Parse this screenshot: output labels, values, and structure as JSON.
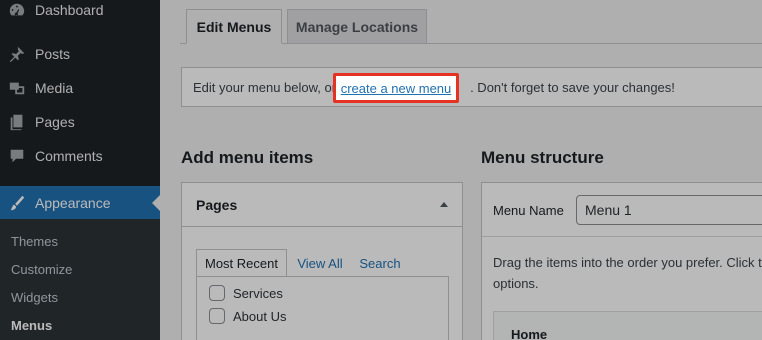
{
  "sidebar": {
    "items": [
      {
        "label": "Dashboard",
        "icon": "dashboard-icon"
      },
      {
        "label": "Posts",
        "icon": "pin-icon"
      },
      {
        "label": "Media",
        "icon": "media-icon"
      },
      {
        "label": "Pages",
        "icon": "pages-icon"
      },
      {
        "label": "Comments",
        "icon": "comment-icon"
      },
      {
        "label": "Appearance",
        "icon": "brush-icon"
      }
    ],
    "submenu": [
      "Themes",
      "Customize",
      "Widgets",
      "Menus"
    ]
  },
  "tabs": {
    "edit": "Edit Menus",
    "manage": "Manage Locations"
  },
  "notice": {
    "before": "Edit your menu below, or",
    "link": "create a new menu",
    "after": ". Don't forget to save your changes!"
  },
  "add_items": {
    "title": "Add menu items",
    "box_title": "Pages",
    "tabs": [
      "Most Recent",
      "View All",
      "Search"
    ],
    "pages": [
      "Services",
      "About Us"
    ]
  },
  "structure": {
    "title": "Menu structure",
    "menu_name_label": "Menu Name",
    "menu_name_value": "Menu 1",
    "instructions_line1": "Drag the items into the order you prefer. Click th",
    "instructions_line2": "options.",
    "first_item": "Home"
  },
  "colors": {
    "sidebar_bg": "#1d2327",
    "accent": "#2271b1",
    "highlight_border": "#e53222"
  }
}
